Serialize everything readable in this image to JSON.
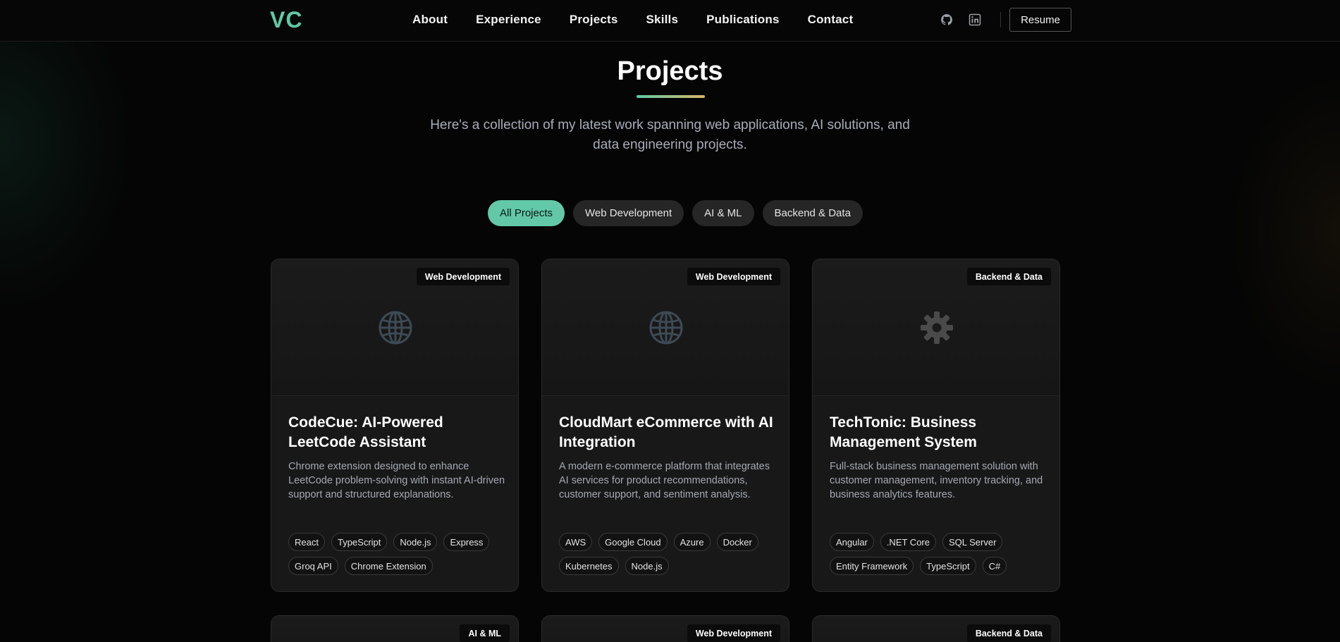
{
  "nav": {
    "logo": "VC",
    "links": [
      "About",
      "Experience",
      "Projects",
      "Skills",
      "Publications",
      "Contact"
    ],
    "resume_label": "Resume",
    "icons": [
      "github-icon",
      "linkedin-icon"
    ]
  },
  "header": {
    "title": "Projects",
    "subtitle": "Here's a collection of my latest work spanning web applications, AI solutions, and data engineering projects."
  },
  "filters": [
    "All Projects",
    "Web Development",
    "AI & ML",
    "Backend & Data"
  ],
  "active_filter": "All Projects",
  "colors": {
    "accent": "#63c8a7",
    "underline_end": "#d8b46b",
    "background": "#050505",
    "card": "#181818"
  },
  "projects": [
    {
      "category": "Web Development",
      "icon": "globe-icon",
      "title": "CodeCue: AI-Powered LeetCode Assistant",
      "description": "Chrome extension designed to enhance LeetCode problem-solving with instant AI-driven support and structured explanations.",
      "tags": [
        "React",
        "TypeScript",
        "Node.js",
        "Express",
        "Groq API",
        "Chrome Extension"
      ]
    },
    {
      "category": "Web Development",
      "icon": "globe-icon",
      "title": "CloudMart eCommerce with AI Integration",
      "description": "A modern e-commerce platform that integrates AI services for product recommendations, customer support, and sentiment analysis.",
      "tags": [
        "AWS",
        "Google Cloud",
        "Azure",
        "Docker",
        "Kubernetes",
        "Node.js"
      ]
    },
    {
      "category": "Backend & Data",
      "icon": "gear-icon",
      "title": "TechTonic: Business Management System",
      "description": "Full-stack business management solution with customer management, inventory tracking, and business analytics features.",
      "tags": [
        "Angular",
        ".NET Core",
        "SQL Server",
        "Entity Framework",
        "TypeScript",
        "C#"
      ]
    }
  ],
  "next_row_badges": [
    "AI & ML",
    "Web Development",
    "Backend & Data"
  ]
}
